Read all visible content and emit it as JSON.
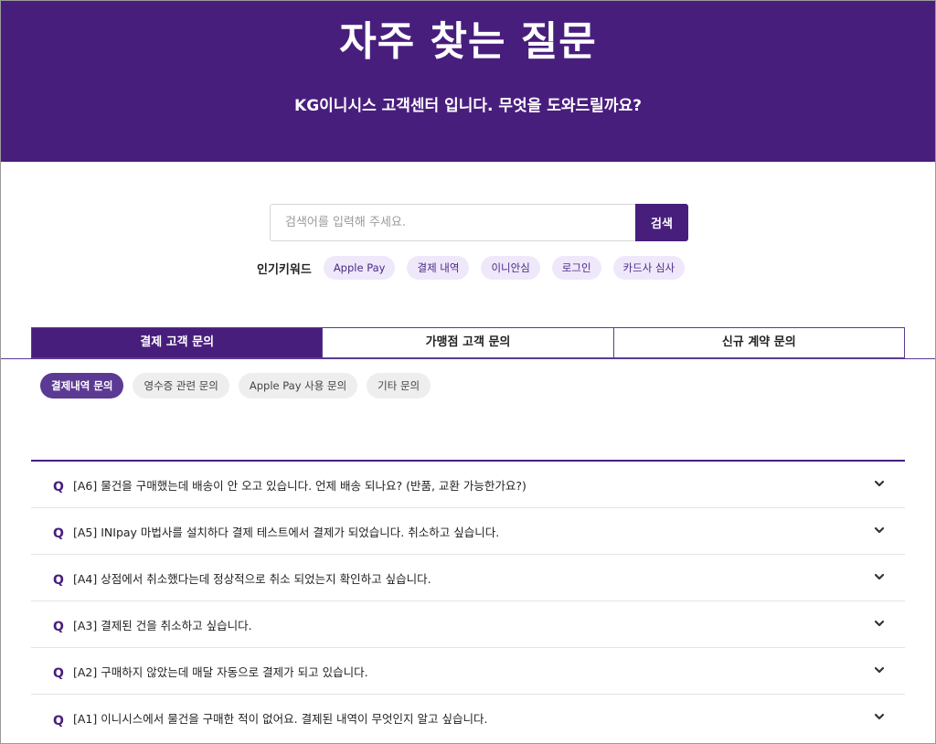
{
  "hero": {
    "title": "자주 찾는 질문",
    "subtitle": "KG이니시스 고객센터 입니다. 무엇을 도와드릴까요?"
  },
  "search": {
    "placeholder": "검색어를 입력해 주세요.",
    "button_label": "검색"
  },
  "keywords": {
    "label": "인기키워드",
    "items": [
      "Apple Pay",
      "결제 내역",
      "이니안심",
      "로그인",
      "카드사 심사"
    ]
  },
  "tabs": [
    {
      "label": "결제 고객 문의",
      "active": true
    },
    {
      "label": "가맹점 고객 문의",
      "active": false
    },
    {
      "label": "신규 계약 문의",
      "active": false
    }
  ],
  "subtabs": [
    {
      "label": "결제내역 문의",
      "active": true
    },
    {
      "label": "영수증 관련 문의",
      "active": false
    },
    {
      "label": "Apple Pay 사용 문의",
      "active": false
    },
    {
      "label": "기타 문의",
      "active": false
    }
  ],
  "faq": {
    "q_marker": "Q",
    "items": [
      "[A6] 물건을 구매했는데 배송이 안 오고 있습니다. 언제 배송 되나요? (반품, 교환 가능한가요?)",
      "[A5] INIpay 마법사를 설치하다 결제 테스트에서 결제가 되었습니다. 취소하고 싶습니다.",
      "[A4] 상점에서 취소했다는데 정상적으로 취소 되었는지 확인하고 싶습니다.",
      "[A3] 결제된 건을 취소하고 싶습니다.",
      "[A2] 구매하지 않았는데 매달 자동으로 결제가 되고 있습니다.",
      "[A1] 이니시스에서 물건을 구매한 적이 없어요. 결제된 내역이 무엇인지 알고 싶습니다."
    ]
  },
  "colors": {
    "brand": "#481e7d",
    "chip_bg": "#efe8fb",
    "subtab_active": "#5b3a94"
  }
}
